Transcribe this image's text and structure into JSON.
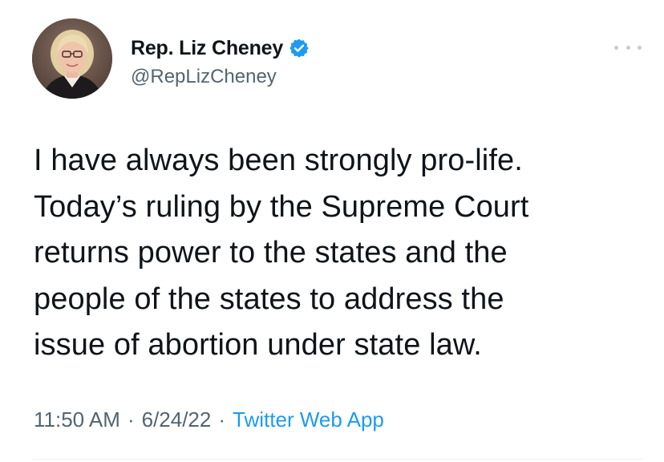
{
  "author": {
    "display_name": "Rep. Liz Cheney",
    "handle": "@RepLizCheney",
    "verified": true
  },
  "tweet": {
    "lines": [
      "I have always been strongly pro-life.",
      "Today’s ruling by the Supreme Court",
      "returns power to the states and the",
      "people of the states to address the",
      "issue of abortion under state law."
    ]
  },
  "meta": {
    "time": "11:50 AM",
    "date": "6/24/22",
    "source": "Twitter Web App",
    "separator": "·"
  },
  "icons": {
    "verified": "verified-badge-icon",
    "more": "more-options-icon"
  },
  "colors": {
    "text": "#0f1419",
    "secondary": "#536471",
    "accent": "#1d9bf0"
  }
}
